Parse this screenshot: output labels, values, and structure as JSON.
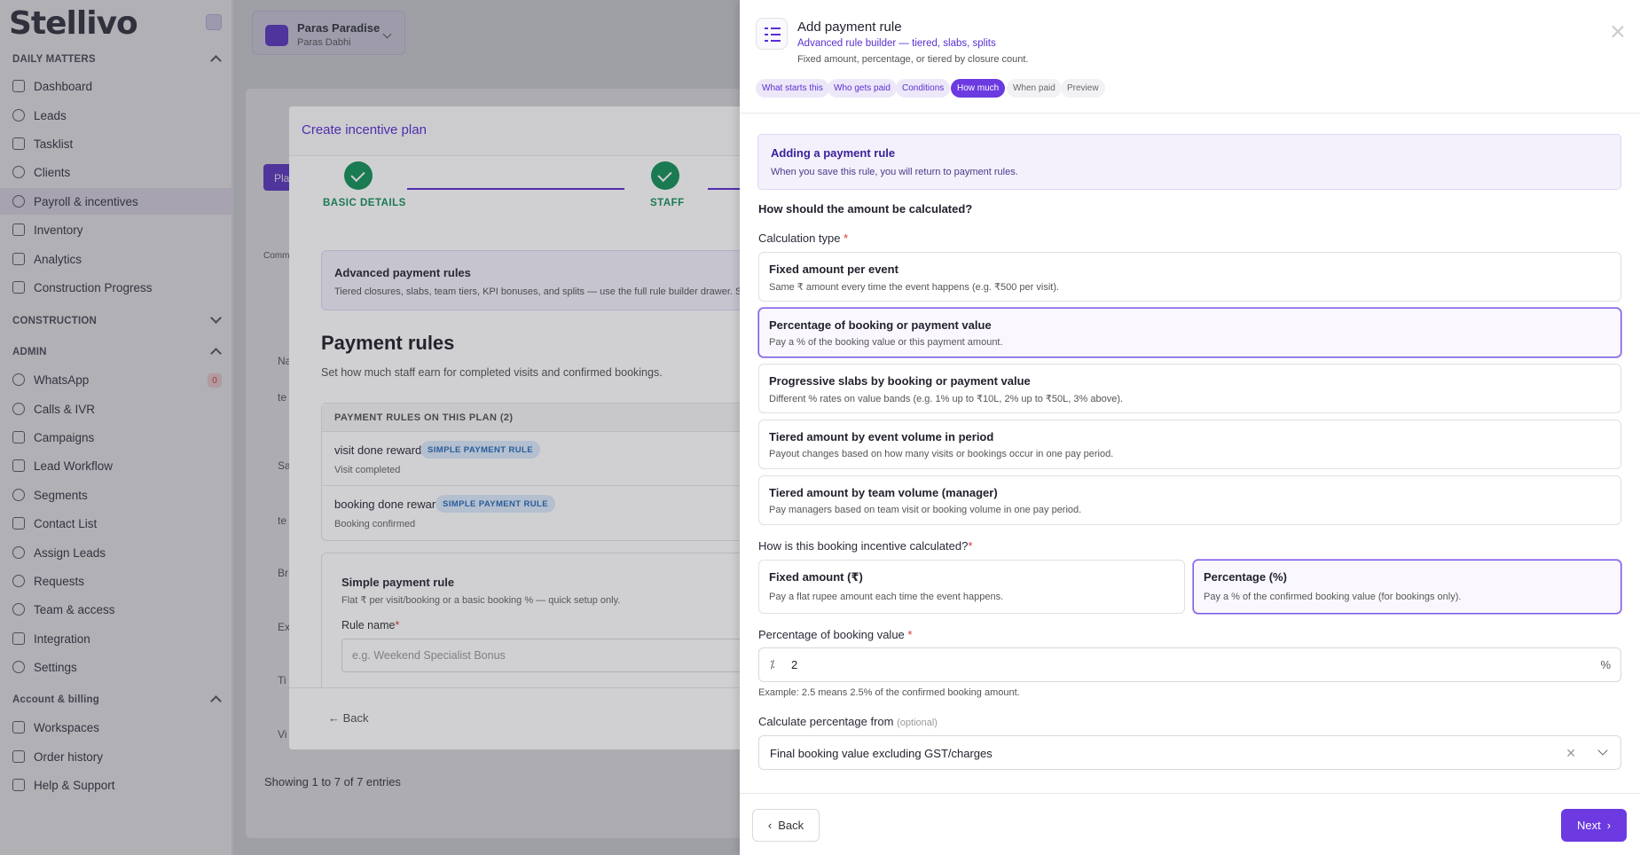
{
  "app": {
    "logo": "Stellivo"
  },
  "sidebar": {
    "sections": [
      {
        "title": "DAILY MATTERS",
        "items": [
          "Dashboard",
          "Leads",
          "Tasklist",
          "Clients",
          "Payroll & incentives",
          "Inventory",
          "Analytics",
          "Construction Progress"
        ]
      },
      {
        "title": "CONSTRUCTION",
        "items": []
      },
      {
        "title": "ADMIN",
        "items": [
          "WhatsApp",
          "Calls & IVR",
          "Campaigns",
          "Lead Workflow",
          "Segments",
          "Contact List",
          "Assign Leads",
          "Requests",
          "Team & access",
          "Integration",
          "Settings"
        ]
      },
      {
        "title": "Account & billing",
        "items": [
          "Workspaces",
          "Order history",
          "Help & Support"
        ]
      }
    ],
    "whatsapp_badge": "0",
    "active_item": "Payroll & incentives"
  },
  "project": {
    "name": "Paras Paradise",
    "sub": "Paras Dabhi"
  },
  "background": {
    "tab_partial": "Pla",
    "col_partial": "Comm",
    "rows_partial": [
      "Na",
      "te",
      "Sa",
      "te",
      "Br",
      "Ex",
      "Ti",
      "Vi"
    ],
    "showing": "Showing 1 to 7 of 7 entries"
  },
  "modal": {
    "title": "Create incentive plan",
    "steps": [
      "BASIC DETAILS",
      "STAFF"
    ],
    "advanced": {
      "title": "Advanced payment rules",
      "desc": "Tiered closures, slabs, team tiers, KPI bonuses, and splits — use the full rule builder drawer. Sir"
    },
    "payment_rules": {
      "title": "Payment rules",
      "subtitle": "Set how much staff earn for completed visits and confirmed bookings.",
      "table_header": "PAYMENT RULES ON THIS PLAN (2)",
      "rows": [
        {
          "name": "visit done reward",
          "tag": "SIMPLE PAYMENT RULE",
          "sub": "Visit completed"
        },
        {
          "name": "booking done reward",
          "tag": "SIMPLE PAYMENT RULE",
          "sub": "Booking confirmed"
        }
      ]
    },
    "simple": {
      "title": "Simple payment rule",
      "desc": "Flat ₹ per visit/booking or a basic booking % — quick setup only.",
      "rule_name_label": "Rule name",
      "rule_name_placeholder": "e.g. Weekend Specialist Bonus"
    },
    "back": "Back"
  },
  "drawer": {
    "title": "Add payment rule",
    "subtitle": "Advanced rule builder — tiered, slabs, splits",
    "description": "Fixed amount, percentage, or tiered by closure count.",
    "tabs": [
      "What starts this",
      "Who gets paid",
      "Conditions",
      "How much",
      "When paid",
      "Preview"
    ],
    "active_tab": "How much",
    "info": {
      "title": "Adding a payment rule",
      "desc": "When you save this rule, you will return to payment rules."
    },
    "question": "How should the amount be calculated?",
    "calc_type_label": "Calculation type",
    "calc_options": [
      {
        "title": "Fixed amount per event",
        "desc": "Same ₹ amount every time the event happens (e.g. ₹500 per visit)."
      },
      {
        "title": "Percentage of booking or payment value",
        "desc": "Pay a % of the booking value or this payment amount."
      },
      {
        "title": "Progressive slabs by booking or payment value",
        "desc": "Different % rates on value bands (e.g. 1% up to ₹10L, 2% up to ₹50L, 3% above)."
      },
      {
        "title": "Tiered amount by event volume in period",
        "desc": "Payout changes based on how many visits or bookings occur in one pay period."
      },
      {
        "title": "Tiered amount by team volume (manager)",
        "desc": "Pay managers based on team visit or booking volume in one pay period."
      }
    ],
    "selected_calc": "Percentage of booking or payment value",
    "incentive_label": "How is this booking incentive calculated?",
    "incentive_options": [
      {
        "title": "Fixed amount (₹)",
        "desc": "Pay a flat rupee amount each time the event happens."
      },
      {
        "title": "Percentage (%)",
        "desc": "Pay a % of the confirmed booking value (for bookings only)."
      }
    ],
    "selected_incentive": "Percentage (%)",
    "pct_label": "Percentage of booking value",
    "pct_prefix": "⁒",
    "pct_value": "2",
    "pct_suffix": "%",
    "pct_example": "Example: 2.5 means 2.5% of the confirmed booking amount.",
    "from_label": "Calculate percentage from",
    "from_optional": "(optional)",
    "from_value": "Final booking value excluding GST/charges",
    "from_clear": "✕",
    "back": "Back",
    "next": "Next"
  }
}
